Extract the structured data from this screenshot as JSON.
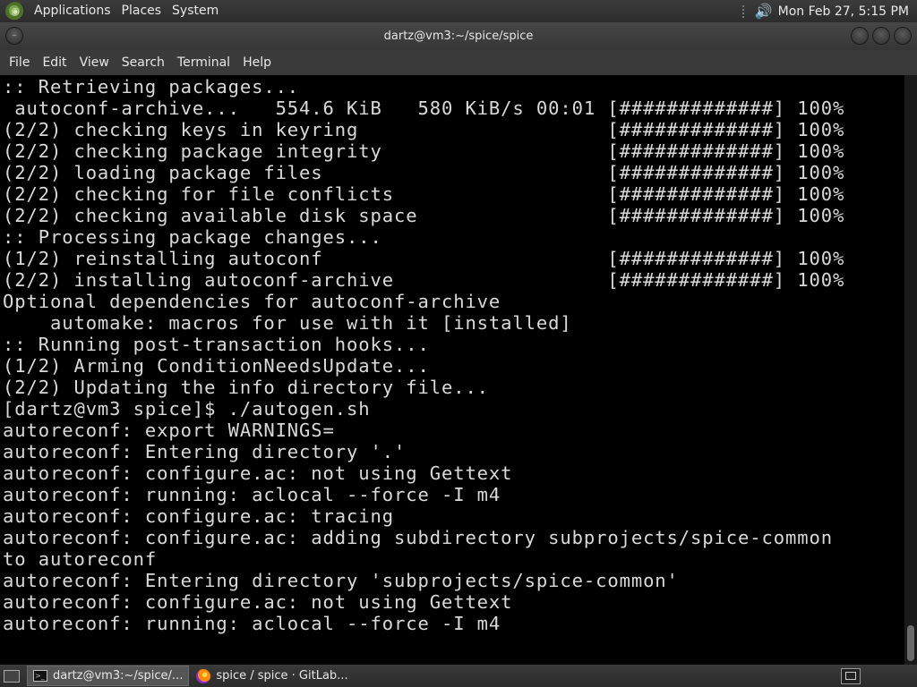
{
  "top_panel": {
    "menus": [
      "Applications",
      "Places",
      "System"
    ],
    "clock": "Mon Feb 27,  5:15 PM",
    "icons": [
      "distro-logo-icon",
      "speaker-icon"
    ]
  },
  "window": {
    "title": "dartz@vm3:~/spice/spice",
    "menus": [
      "File",
      "Edit",
      "View",
      "Search",
      "Terminal",
      "Help"
    ]
  },
  "terminal": {
    "lines": [
      ":: Retrieving packages...",
      " autoconf-archive...   554.6 KiB   580 KiB/s 00:01 [#############] 100%",
      "(2/2) checking keys in keyring                     [#############] 100%",
      "(2/2) checking package integrity                   [#############] 100%",
      "(2/2) loading package files                        [#############] 100%",
      "(2/2) checking for file conflicts                  [#############] 100%",
      "(2/2) checking available disk space                [#############] 100%",
      ":: Processing package changes...",
      "(1/2) reinstalling autoconf                        [#############] 100%",
      "(2/2) installing autoconf-archive                  [#############] 100%",
      "Optional dependencies for autoconf-archive",
      "    automake: macros for use with it [installed]",
      ":: Running post-transaction hooks...",
      "(1/2) Arming ConditionNeedsUpdate...",
      "(2/2) Updating the info directory file...",
      "[dartz@vm3 spice]$ ./autogen.sh",
      "autoreconf: export WARNINGS=",
      "autoreconf: Entering directory '.'",
      "autoreconf: configure.ac: not using Gettext",
      "autoreconf: running: aclocal --force -I m4",
      "autoreconf: configure.ac: tracing",
      "autoreconf: configure.ac: adding subdirectory subprojects/spice-common",
      "to autoreconf",
      "autoreconf: Entering directory 'subprojects/spice-common'",
      "autoreconf: configure.ac: not using Gettext",
      "autoreconf: running: aclocal --force -I m4"
    ]
  },
  "taskbar": {
    "tasks": [
      {
        "label": "dartz@vm3:~/spice/...",
        "icon": "terminal-icon",
        "active": true
      },
      {
        "label": "spice / spice · GitLab...",
        "icon": "firefox-icon",
        "active": false
      }
    ]
  }
}
